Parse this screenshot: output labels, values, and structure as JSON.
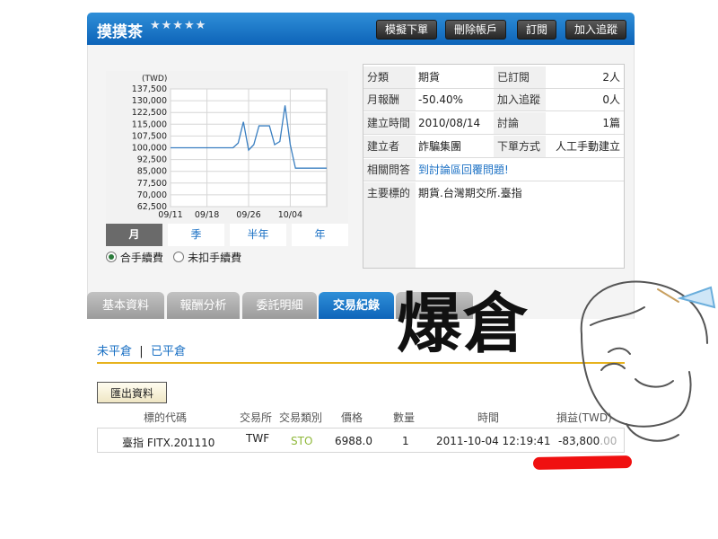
{
  "header": {
    "title": "摸摸茶",
    "stars": "★★★★★",
    "buttons": [
      "模擬下單",
      "刪除帳戶",
      "訂閱",
      "加入追蹤"
    ]
  },
  "chart_data": {
    "type": "line",
    "ylabel": "(TWD)",
    "y_ticks": [
      137500,
      130000,
      122500,
      115000,
      107500,
      100000,
      92500,
      85000,
      77500,
      70000,
      62500
    ],
    "y_tick_labels": [
      "137,500",
      "130,000",
      "122,500",
      "115,000",
      "107,500",
      "100,000",
      "92,500",
      "85,000",
      "77,500",
      "70,000",
      "62,500"
    ],
    "ylim": [
      62500,
      137500
    ],
    "x_tick_labels": [
      "09/11",
      "09/18",
      "09/26",
      "10/04"
    ],
    "x_tick_days": [
      0,
      7,
      15,
      23
    ],
    "xlim": [
      0,
      30
    ],
    "series": [
      {
        "x": [
          0,
          12,
          13,
          14,
          15,
          16,
          17,
          18,
          19,
          20,
          21,
          22,
          23,
          24,
          25,
          26,
          27,
          28,
          29,
          30
        ],
        "values": [
          100000,
          100000,
          103000,
          116500,
          98500,
          102000,
          114000,
          114000,
          114000,
          102000,
          104000,
          127000,
          102000,
          87000,
          87000,
          87000,
          87000,
          87000,
          87000,
          87000
        ]
      }
    ],
    "grid": true,
    "color": "#3a7fc1"
  },
  "periods": {
    "items": [
      "月",
      "季",
      "半年",
      "年"
    ],
    "active": 0
  },
  "fee_options": {
    "with_fee": "合手續費",
    "without_fee": "未扣手續費"
  },
  "info": {
    "category_label": "分類",
    "category_value": "期貨",
    "subscribed_label": "已訂閱",
    "subscribed_value": "2人",
    "monthly_return_label": "月報酬",
    "monthly_return_value": "-50.40%",
    "followers_label": "加入追蹤",
    "followers_value": "0人",
    "created_label": "建立時間",
    "created_value": "2010/08/14",
    "discussion_label": "討論",
    "discussion_value": "1篇",
    "creator_label": "建立者",
    "creator_value": "詐騙集團",
    "order_method_label": "下單方式",
    "order_method_value": "人工手動建立",
    "qa_label": "相關問答",
    "qa_link": "到討論區回覆問題!",
    "targets_label": "主要標的",
    "targets_value": "期貨.台灣期交所.臺指"
  },
  "tabs": [
    "基本資料",
    "報酬分析",
    "委託明細",
    "交易紀錄"
  ],
  "active_tab": 3,
  "subnav": {
    "open": "未平倉",
    "sep": "|",
    "closed": "已平倉"
  },
  "export_label": "匯出資料",
  "table": {
    "headers": [
      "標的代碼",
      "交易所",
      "交易類別",
      "價格",
      "數量",
      "時間",
      "損益(TWD)"
    ],
    "row": {
      "symbol": "臺指 FITX.201110",
      "exchange": "TWF",
      "type": "STO",
      "price": "6988.0",
      "qty": "1",
      "time": "2011-10-04 12:19:41",
      "pnl_main": "-83,800",
      "pnl_dec": ".00"
    }
  },
  "overlay": {
    "stamp_text": "爆倉"
  },
  "colors": {
    "accent": "#0d63b8",
    "link": "#1a70c4",
    "divider": "#e7b21d",
    "sto": "#8fb83a",
    "highlight_mark": "#f01010"
  }
}
